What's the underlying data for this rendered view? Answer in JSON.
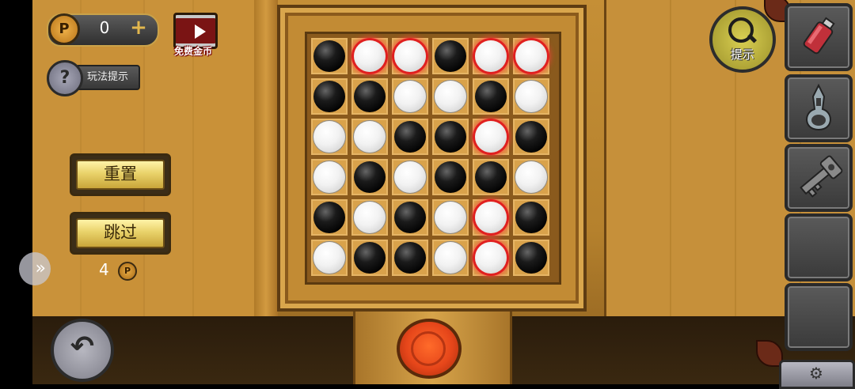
{
  "currency": {
    "coin_symbol": "P",
    "balance": "0",
    "add_symbol": "+"
  },
  "free_coins": {
    "label": "免费金币"
  },
  "rules_button": {
    "icon_glyph": "?",
    "label": "玩法提示"
  },
  "reset_button": {
    "label": "重置"
  },
  "skip_button": {
    "label": "跳过",
    "cost": "4",
    "cost_coin_symbol": "P"
  },
  "hint_button": {
    "label": "提示"
  },
  "board": {
    "rows": 6,
    "cols": 6,
    "cells": [
      [
        "black",
        "white",
        "white",
        "black",
        "white",
        "white"
      ],
      [
        "black",
        "black",
        "white",
        "white",
        "black",
        "white"
      ],
      [
        "white",
        "white",
        "black",
        "black",
        "white",
        "black"
      ],
      [
        "white",
        "black",
        "white",
        "black",
        "black",
        "white"
      ],
      [
        "black",
        "white",
        "black",
        "white",
        "white",
        "black"
      ],
      [
        "white",
        "black",
        "black",
        "white",
        "white",
        "black"
      ]
    ],
    "highlighted": [
      [
        0,
        1
      ],
      [
        0,
        2
      ],
      [
        0,
        4
      ],
      [
        0,
        5
      ],
      [
        2,
        4
      ],
      [
        4,
        4
      ],
      [
        5,
        4
      ]
    ],
    "colors": {
      "black": "#000000",
      "white": "#f2f2f2",
      "highlight": "#e02020"
    }
  },
  "inventory": {
    "slots": [
      {
        "item": "potion-bottle-icon"
      },
      {
        "item": "can-opener-icon"
      },
      {
        "item": "key-icon"
      },
      {
        "item": ""
      },
      {
        "item": ""
      }
    ]
  },
  "icons": {
    "side_tab": "chevron-right-icon",
    "back": "undo-arrow-icon",
    "settings": "gear-icon",
    "action": "red-round-button"
  }
}
